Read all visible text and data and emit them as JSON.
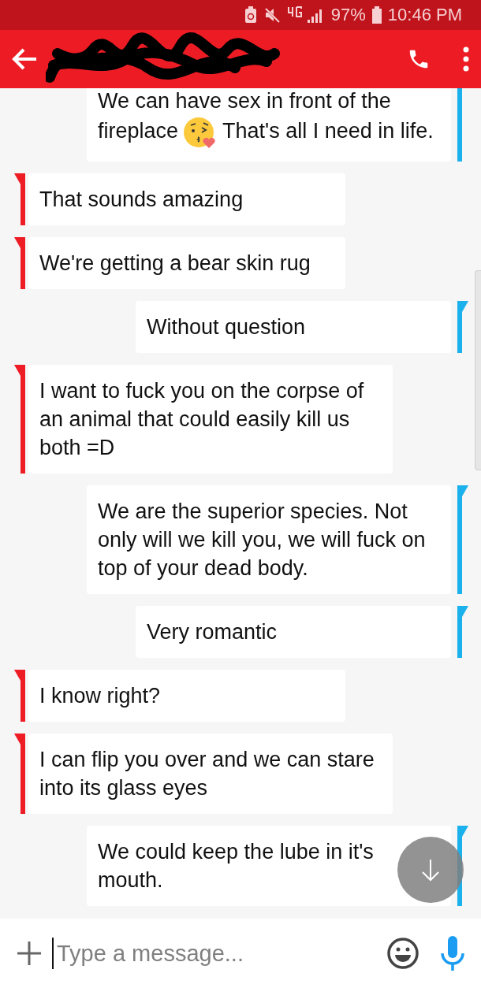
{
  "status_bar": {
    "battery": "97%",
    "time": "10:46 PM"
  },
  "input": {
    "placeholder": "Type a message..."
  },
  "messages": [
    {
      "kind": "sent",
      "segments": [
        {
          "kind": "text",
          "text": "We can have sex in front of the fireplace"
        },
        {
          "kind": "emoji"
        },
        {
          "kind": "text",
          "text": "That's all I need in life."
        }
      ]
    },
    {
      "kind": "received",
      "segments": [
        {
          "kind": "text",
          "text": "That sounds amazing"
        }
      ]
    },
    {
      "kind": "received",
      "segments": [
        {
          "kind": "text",
          "text": "We're getting a bear skin rug"
        }
      ]
    },
    {
      "kind": "sent",
      "segments": [
        {
          "kind": "text",
          "text": "Without question"
        }
      ]
    },
    {
      "kind": "received",
      "segments": [
        {
          "kind": "text",
          "text": "I want to fuck you on the corpse of an animal that could easily kill us both =D"
        }
      ]
    },
    {
      "kind": "sent",
      "segments": [
        {
          "kind": "text",
          "text": "We are the superior species. Not only will we kill you, we will fuck on top of your dead body."
        }
      ]
    },
    {
      "kind": "sent",
      "segments": [
        {
          "kind": "text",
          "text": "Very romantic"
        }
      ]
    },
    {
      "kind": "received",
      "segments": [
        {
          "kind": "text",
          "text": "I know right?"
        }
      ]
    },
    {
      "kind": "received",
      "segments": [
        {
          "kind": "text",
          "text": "I can flip you over and we can stare into its glass eyes"
        }
      ]
    },
    {
      "kind": "sent",
      "segments": [
        {
          "kind": "text",
          "text": "We could keep the lube in it's mouth."
        }
      ]
    }
  ]
}
